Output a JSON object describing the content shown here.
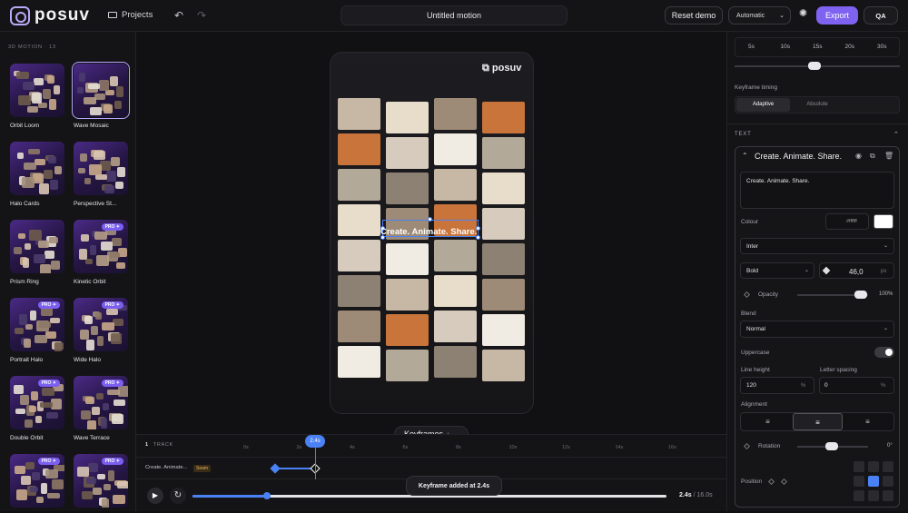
{
  "app": {
    "logo_text": "posuv"
  },
  "topbar": {
    "projects_label": "Projects",
    "document_title": "Untitled motion",
    "reset_label": "Reset demo",
    "mode_select": "Automatic",
    "export_label": "Export",
    "qa_label": "QA"
  },
  "left_panel": {
    "section_title": "3D MOTION · 13",
    "templates": [
      {
        "name": "Orbit Loom",
        "pro": false
      },
      {
        "name": "Wave Mosaic",
        "pro": false,
        "selected": true
      },
      {
        "name": "Halo Cards",
        "pro": false
      },
      {
        "name": "Perspective St...",
        "pro": false
      },
      {
        "name": "Prism Ring",
        "pro": false
      },
      {
        "name": "Kinetic Orbit",
        "pro": true
      },
      {
        "name": "Portrait Halo",
        "pro": true
      },
      {
        "name": "Wide Halo",
        "pro": true
      },
      {
        "name": "Double Orbit",
        "pro": true
      },
      {
        "name": "Wave Terrace",
        "pro": true
      },
      {
        "name": "",
        "pro": true
      },
      {
        "name": "",
        "pro": true
      }
    ],
    "pro_badge": "PRO ✦"
  },
  "canvas": {
    "phone_logo": "posuv",
    "caption": "Create. Animate. Share.",
    "keyframes_button": "Keyframes",
    "keyframes_count": "1"
  },
  "timeline": {
    "track_count": "1",
    "track_label": "TRACK",
    "ticks": [
      "0s",
      "2s",
      "4s",
      "6s",
      "8s",
      "10s",
      "12s",
      "14s",
      "16s"
    ],
    "row_name": "Create. Animate...",
    "row_tag": "Seam",
    "playhead_badge": "2.4s",
    "current_time": "2.4s",
    "total_time": "/ 16.0s",
    "toast": "Keyframe added at 2.4s",
    "progress_fraction": 0.15
  },
  "right_panel": {
    "durations": [
      "5s",
      "10s",
      "15s",
      "20s",
      "30s"
    ],
    "keyframe_timing_label": "Keyframe timing",
    "timing_options": [
      "Adaptive",
      "Absolute"
    ],
    "section_text": "TEXT",
    "card_title": "Create. Animate. Share.",
    "text_value": "Create. Animate. Share.",
    "colour_label": "Colour",
    "colour_hex": "#ffffff",
    "font_family": "Inter",
    "font_weight": "Bold",
    "font_size": "46,0",
    "font_size_unit": "px",
    "opacity_label": "Opacity",
    "opacity_value": "100%",
    "blend_label": "Blend",
    "blend_value": "Normal",
    "uppercase_label": "Uppercase",
    "line_height_label": "Line height",
    "line_height_value": "120",
    "line_height_unit": "%",
    "letter_spacing_label": "Letter spacing",
    "letter_spacing_value": "0",
    "letter_spacing_unit": "%",
    "alignment_label": "Alignment",
    "rotation_label": "Rotation",
    "rotation_value": "0°",
    "position_label": "Position"
  },
  "colors": {
    "accent": "#7f63f0",
    "blue": "#4a82f5",
    "bg": "#0f0f11"
  }
}
